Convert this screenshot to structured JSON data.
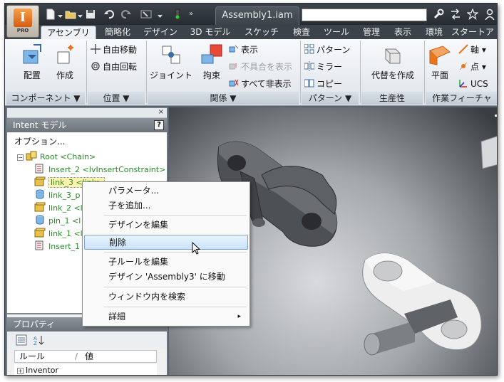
{
  "titlebar": {
    "app_pro_label": "PRO",
    "document_tab": "Assembly1.iam",
    "search_placeholder": ""
  },
  "ribbon_tabs": [
    "アセンブリ",
    "簡略化",
    "デザイン",
    "3D モデル",
    "スケッチ",
    "検査",
    "ツール",
    "管理",
    "表示",
    "環境",
    "スタートア"
  ],
  "ribbon": {
    "component": {
      "title": "コンポーネント ▼",
      "place": "配置",
      "create": "作成"
    },
    "position": {
      "title": "位置 ▼",
      "free_move": "自由移動",
      "free_rotate": "自由回転"
    },
    "relations": {
      "title": "関係 ▼",
      "joint": "ジョイント",
      "constrain": "拘束",
      "show": "表示",
      "show_sick": "不具合を表示",
      "hide_all": "すべて非表示"
    },
    "pattern": {
      "title": "パターン ▼",
      "pattern": "パターン",
      "mirror": "ミラー",
      "copy": "コピー"
    },
    "productivity": {
      "title": "生産性",
      "substitute": "代替を作成"
    },
    "work_features": {
      "title": "作業フィーチャ",
      "plane": "平面",
      "axis": "軸 ▾",
      "point": "点 ▾",
      "ucs": "UCS"
    }
  },
  "intent_panel": {
    "title": "Intent モデル",
    "help_label": "?",
    "close_label": "×",
    "options": "オプション...",
    "tree": [
      {
        "label": "Root <Chain>",
        "icon": "assembly-icon"
      },
      {
        "label": "Insert_2 <IvInsertConstraint>",
        "icon": "constraint-icon"
      },
      {
        "label": "link_3 <link>",
        "icon": "part-icon"
      },
      {
        "label": "link_3_p",
        "icon": "pin-icon"
      },
      {
        "label": "link_2 <l",
        "icon": "part-icon"
      },
      {
        "label": "pin_1 <l",
        "icon": "pin-icon"
      },
      {
        "label": "link_1 <l",
        "icon": "part-icon"
      },
      {
        "label": "Insert_1",
        "icon": "constraint-icon"
      }
    ]
  },
  "properties_panel": {
    "title": "プロパティ",
    "col_rule": "ルール",
    "col_value": "値",
    "row_first": "Inventor"
  },
  "context_menu": {
    "items": [
      "パラメータ...",
      "子を追加...",
      "デザインを編集",
      "削除",
      "子ルールを編集",
      "デザイン 'Assembly3' に移動",
      "ウィンドウ内を検索",
      "詳細"
    ],
    "submenu_arrow": "▸"
  },
  "colors": {
    "accent_orange": "#e8761e",
    "tree_green": "#2a8a2a",
    "menu_hover": "#c8e2fa",
    "titlebar_dark": "#272c32"
  }
}
